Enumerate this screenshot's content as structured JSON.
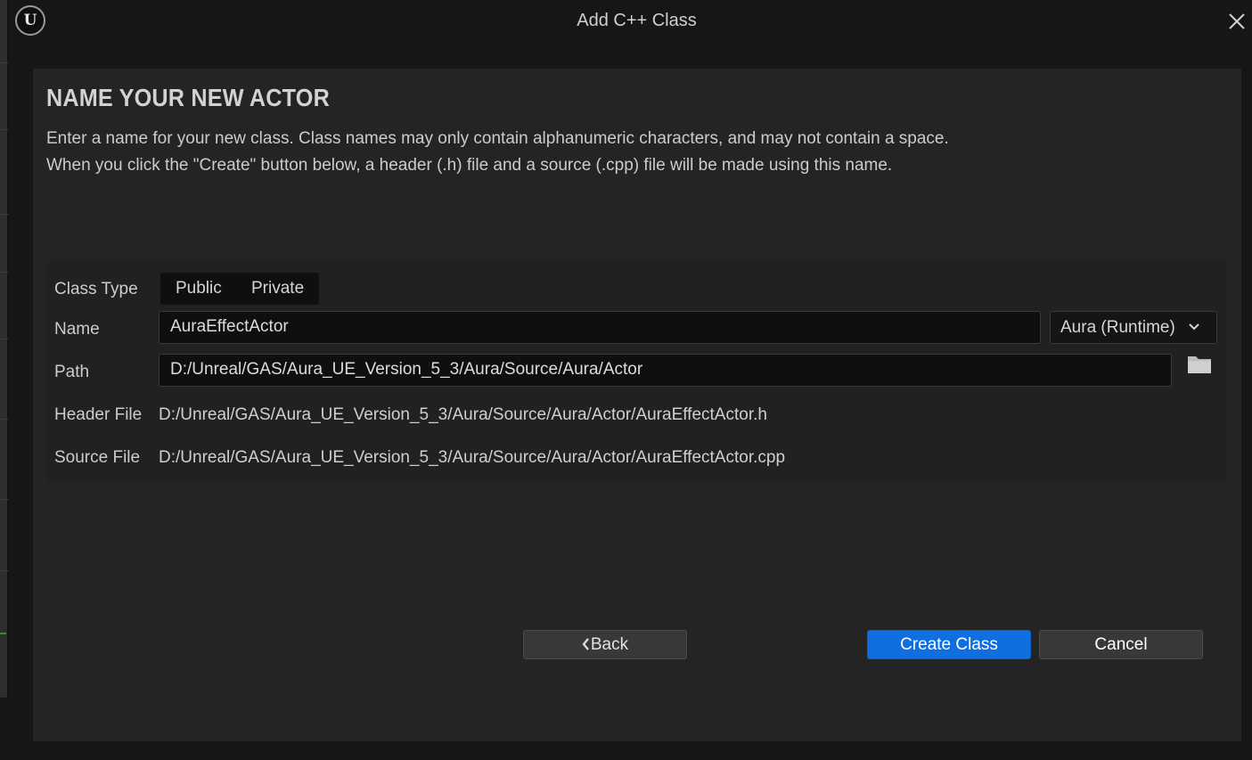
{
  "window": {
    "title": "Add C++ Class",
    "logo_icon": "unreal-engine-logo",
    "logo_text": "U"
  },
  "page": {
    "heading": "NAME YOUR NEW ACTOR",
    "description_line1": "Enter a name for your new class. Class names may only contain alphanumeric characters, and may not contain a space.",
    "description_line2": "When you click the \"Create\" button below, a header (.h) file and a source (.cpp) file will be made using this name."
  },
  "form": {
    "class_type": {
      "label": "Class Type",
      "options": [
        "Public",
        "Private"
      ]
    },
    "name": {
      "label": "Name",
      "value": "AuraEffectActor",
      "module": "Aura (Runtime)"
    },
    "path": {
      "label": "Path",
      "value": "D:/Unreal/GAS/Aura_UE_Version_5_3/Aura/Source/Aura/Actor"
    },
    "header_file": {
      "label": "Header File",
      "value": "D:/Unreal/GAS/Aura_UE_Version_5_3/Aura/Source/Aura/Actor/AuraEffectActor.h"
    },
    "source_file": {
      "label": "Source File",
      "value": "D:/Unreal/GAS/Aura_UE_Version_5_3/Aura/Source/Aura/Actor/AuraEffectActor.cpp"
    }
  },
  "buttons": {
    "back": "Back",
    "create": "Create Class",
    "cancel": "Cancel"
  },
  "colors": {
    "accent": "#0f6fe0",
    "panel": "#242424",
    "field": "#0f0f0f"
  }
}
